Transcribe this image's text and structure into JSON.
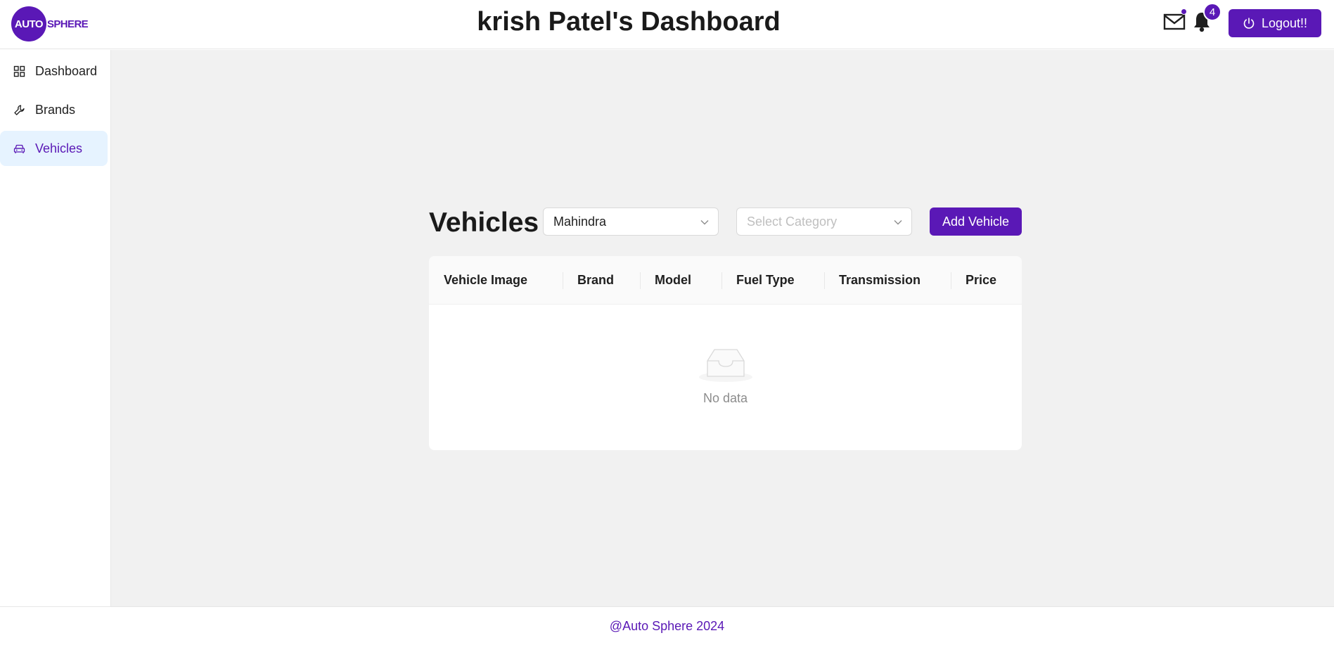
{
  "brand": {
    "logo_circle_text": "AUTO",
    "logo_rest_text": "SPHERE",
    "accent_color": "#5a18b6"
  },
  "header": {
    "title": "krish Patel's Dashboard",
    "mail_icon": "mail-icon",
    "bell_icon": "bell-icon",
    "notification_count": "4",
    "logout_label": "Logout!!"
  },
  "sidebar": {
    "items": [
      {
        "label": "Dashboard",
        "icon": "grid-icon",
        "active": false
      },
      {
        "label": "Brands",
        "icon": "wrench-icon",
        "active": false
      },
      {
        "label": "Vehicles",
        "icon": "car-icon",
        "active": true
      }
    ],
    "active_bg": "#e6f3ff"
  },
  "main": {
    "heading": "Vehicles",
    "brand_select": {
      "value": "Mahindra"
    },
    "category_select": {
      "placeholder": "Select Category"
    },
    "add_button_label": "Add Vehicle",
    "table": {
      "columns": [
        "Vehicle Image",
        "Brand",
        "Model",
        "Fuel Type",
        "Transmission",
        "Price"
      ],
      "rows": [],
      "empty_text": "No data"
    }
  },
  "footer": {
    "text": "@Auto Sphere 2024"
  }
}
